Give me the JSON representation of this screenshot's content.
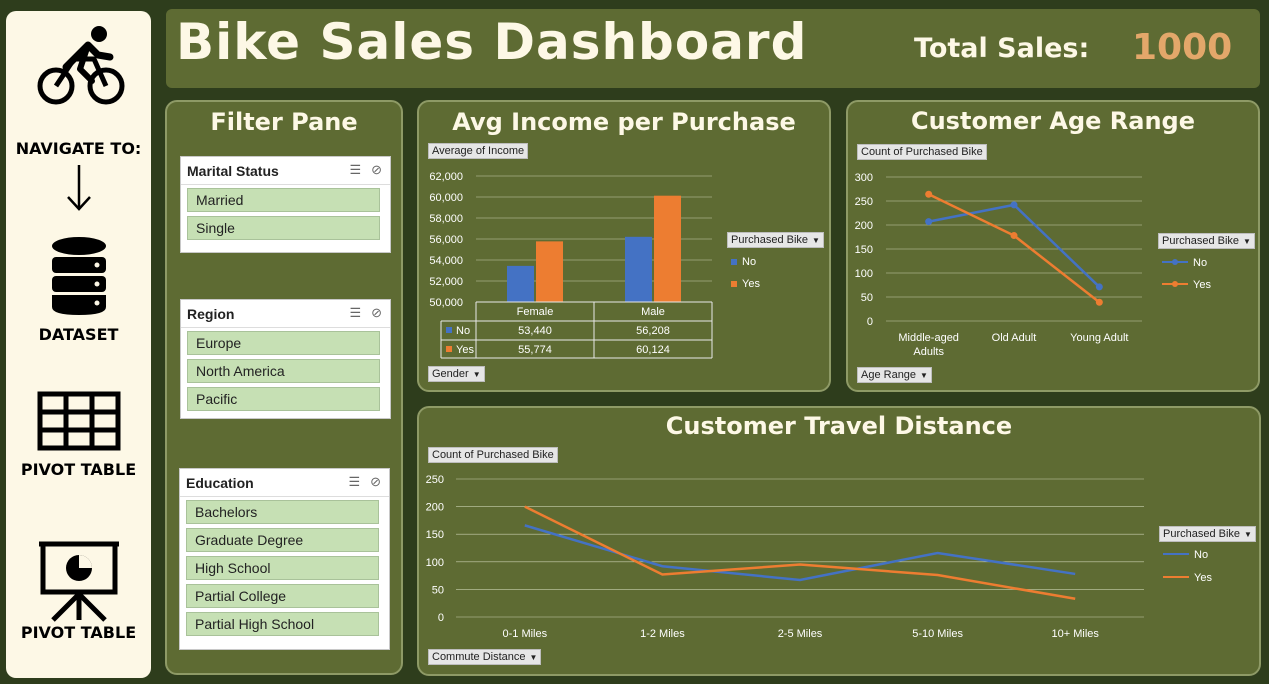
{
  "nav": {
    "navigate_label": "NAVIGATE TO:",
    "items": [
      {
        "label": "DATASET",
        "icon": "database-icon"
      },
      {
        "label": "PIVOT TABLE",
        "icon": "grid-table-icon"
      },
      {
        "label": "PIVOT TABLE",
        "icon": "presentation-chart-icon"
      }
    ]
  },
  "header": {
    "title": "Bike Sales Dashboard",
    "total_sales_label": "Total Sales:",
    "total_sales_value": "1000"
  },
  "filter_pane": {
    "title": "Filter Pane",
    "slicers": [
      {
        "title": "Marital Status",
        "items": [
          "Married",
          "Single"
        ]
      },
      {
        "title": "Region",
        "items": [
          "Europe",
          "North America",
          "Pacific"
        ]
      },
      {
        "title": "Education",
        "items": [
          "Bachelors",
          "Graduate Degree",
          "High School",
          "Partial College",
          "Partial High School"
        ]
      }
    ]
  },
  "colors": {
    "no": "#4472c4",
    "yes": "#ed7d31",
    "panel": "#5e6b33",
    "accent": "#e3a76a"
  },
  "income_chart": {
    "title": "Avg Income per Purchase",
    "value_field": "Average of Income",
    "legend_title": "Purchased Bike",
    "axis_field": "Gender",
    "table_rows": [
      {
        "label": "No",
        "values": [
          "53,440",
          "56,208"
        ]
      },
      {
        "label": "Yes",
        "values": [
          "55,774",
          "60,124"
        ]
      }
    ]
  },
  "age_chart": {
    "title": "Customer Age Range",
    "value_field": "Count of Purchased Bike",
    "legend_title": "Purchased Bike",
    "axis_field": "Age Range"
  },
  "distance_chart": {
    "title": "Customer Travel Distance",
    "value_field": "Count of Purchased Bike",
    "legend_title": "Purchased Bike",
    "axis_field": "Commute Distance"
  },
  "chart_data": [
    {
      "type": "bar",
      "title": "Avg Income per Purchase",
      "categories": [
        "Female",
        "Male"
      ],
      "series": [
        {
          "name": "No",
          "values": [
            53440,
            56208
          ]
        },
        {
          "name": "Yes",
          "values": [
            55774,
            60124
          ]
        }
      ],
      "ylim": [
        50000,
        62000
      ],
      "yticks": [
        50000,
        52000,
        54000,
        56000,
        58000,
        60000,
        62000
      ],
      "ytick_labels": [
        "50,000",
        "52,000",
        "54,000",
        "56,000",
        "58,000",
        "60,000",
        "62,000"
      ],
      "legend": "right",
      "grid": true
    },
    {
      "type": "line",
      "title": "Customer Age Range",
      "categories": [
        "Middle-aged Adults",
        "Old Adult",
        "Young Adult"
      ],
      "category_lines": [
        [
          "Middle-aged",
          "Adults"
        ],
        [
          "Old Adult"
        ],
        [
          "Young Adult"
        ]
      ],
      "series": [
        {
          "name": "No",
          "values": [
            207,
            242,
            71
          ]
        },
        {
          "name": "Yes",
          "values": [
            264,
            178,
            39
          ]
        }
      ],
      "ylim": [
        0,
        300
      ],
      "yticks": [
        0,
        50,
        100,
        150,
        200,
        250,
        300
      ],
      "legend": "right",
      "grid": true
    },
    {
      "type": "line",
      "title": "Customer Travel Distance",
      "categories": [
        "0-1 Miles",
        "1-2 Miles",
        "2-5 Miles",
        "5-10 Miles",
        "10+ Miles"
      ],
      "series": [
        {
          "name": "No",
          "values": [
            166,
            92,
            67,
            116,
            78
          ]
        },
        {
          "name": "Yes",
          "values": [
            200,
            77,
            95,
            76,
            33
          ]
        }
      ],
      "ylim": [
        0,
        250
      ],
      "yticks": [
        0,
        50,
        100,
        150,
        200,
        250
      ],
      "legend": "right",
      "grid": true
    }
  ]
}
